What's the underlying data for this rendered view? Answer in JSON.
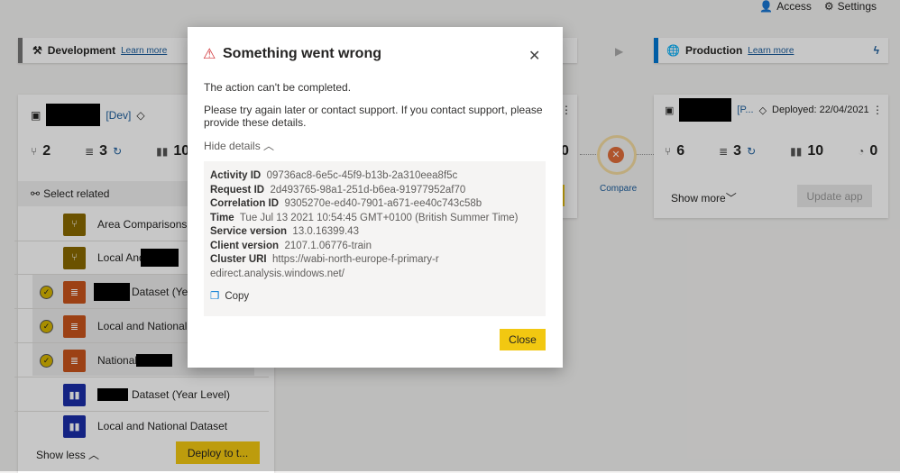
{
  "topbar": {
    "access": "Access",
    "settings": "Settings"
  },
  "dev": {
    "title": "Development",
    "learn": "Learn more",
    "tag": "[Dev]",
    "stats": {
      "dataflows": "2",
      "datasets": "3",
      "reports": "10"
    },
    "select_related": "Select related",
    "items": [
      {
        "label": "Area Comparisons (",
        "type": "dataflow",
        "checked": false
      },
      {
        "label": "Local And",
        "type": "dataflow",
        "checked": false
      },
      {
        "label": "Dataset (Yea",
        "type": "dataset",
        "checked": true
      },
      {
        "label": "Local and National D",
        "type": "dataset",
        "checked": true
      },
      {
        "label": "National",
        "suffix": "(Y",
        "type": "dataset",
        "checked": true
      },
      {
        "label": "Dataset (Year Level)",
        "type": "report",
        "checked": false
      },
      {
        "label": "Local and National Dataset",
        "type": "report",
        "checked": false
      }
    ],
    "show_less": "Show less",
    "deploy": "Deploy to t..."
  },
  "test": {
    "stat": "0"
  },
  "compare": {
    "label": "Compare"
  },
  "prod": {
    "title": "Production",
    "learn": "Learn more",
    "tag": "[P...",
    "deployed": "Deployed: 22/04/2021",
    "stats": {
      "dataflows": "6",
      "datasets": "3",
      "reports": "10",
      "dashboards": "0"
    },
    "show_more": "Show more",
    "update": "Update app"
  },
  "modal": {
    "title": "Something went wrong",
    "message": "The action can't be completed.",
    "instructions": "Please try again later or contact support. If you contact support, please provide these details.",
    "hide_details": "Hide details",
    "details": [
      {
        "k": "Activity ID",
        "v": "09736ac8-6e5c-45f9-b13b-2a310eea8f5c"
      },
      {
        "k": "Request ID",
        "v": "2d493765-98a1-251d-b6ea-91977952af70"
      },
      {
        "k": "Correlation ID",
        "v": "9305270e-ed40-7901-a671-ee40c743c58b"
      },
      {
        "k": "Time",
        "v": "Tue Jul 13 2021 10:54:45 GMT+0100 (British Summer Time)"
      },
      {
        "k": "Service version",
        "v": "13.0.16399.43"
      },
      {
        "k": "Client version",
        "v": "2107.1.06776-train"
      },
      {
        "k": "Cluster URI",
        "v": "https://wabi-north-europe-f-primary-redirect.analysis.windows.net/"
      }
    ],
    "copy": "Copy",
    "close": "Close"
  },
  "colors": {
    "accent": "#f2c811",
    "dataflow": "#8a6a00",
    "dataset": "#c8541c",
    "report": "#1a2ea8",
    "prod_bar": "#0078d4",
    "error": "#d13438"
  }
}
